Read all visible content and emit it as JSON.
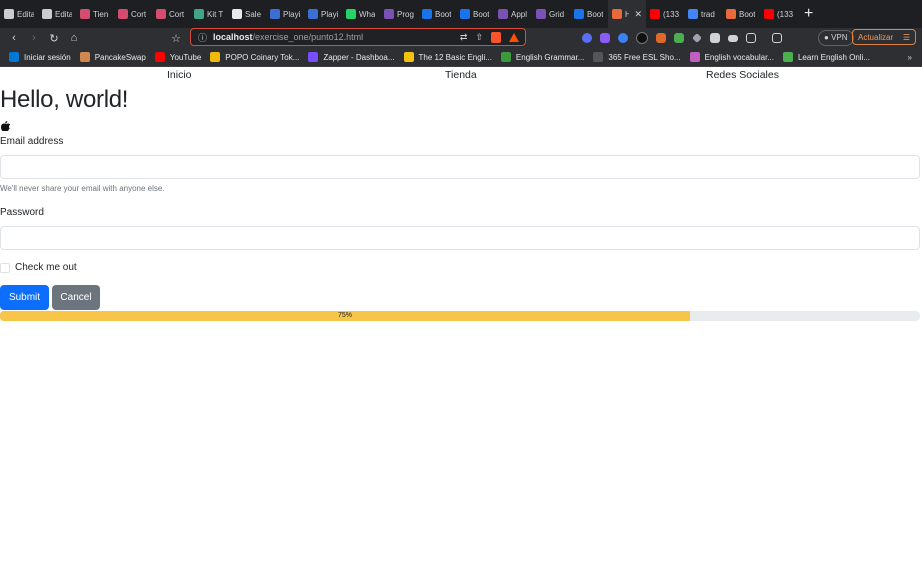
{
  "browser": {
    "tabs": [
      {
        "label": "Edita",
        "color": "#c9cdd2"
      },
      {
        "label": "Edita",
        "color": "#c9cdd2"
      },
      {
        "label": "Tien",
        "color": "#d44d6e"
      },
      {
        "label": "Cort",
        "color": "#d44d6e"
      },
      {
        "label": "Cort",
        "color": "#d44d6e"
      },
      {
        "label": "Kit T",
        "color": "#3fa68a"
      },
      {
        "label": "Sale",
        "color": "#e8eaed"
      },
      {
        "label": "Playi",
        "color": "#3b6fd4"
      },
      {
        "label": "Playi",
        "color": "#3b6fd4"
      },
      {
        "label": "Wha",
        "color": "#25d366"
      },
      {
        "label": "Prog",
        "color": "#7952b3"
      },
      {
        "label": "Boot",
        "color": "#1a73e8"
      },
      {
        "label": "Boot",
        "color": "#1a73e8"
      },
      {
        "label": "Appl",
        "color": "#7952b3"
      },
      {
        "label": "Grid",
        "color": "#7952b3"
      },
      {
        "label": "Boot",
        "color": "#1a73e8"
      },
      {
        "label": "H",
        "color": "#e86a3c",
        "active": true
      },
      {
        "label": "(133",
        "color": "#ff0000"
      },
      {
        "label": "trad",
        "color": "#4285f4"
      },
      {
        "label": "Boot",
        "color": "#e86a3c"
      },
      {
        "label": "(133",
        "color": "#ff0000"
      }
    ],
    "url_host": "localhost",
    "url_path": "/exercise_one/punto12.html",
    "vpn_label": "VPN",
    "update_label": "Actualizar",
    "bookmarks": [
      {
        "label": "Iniciar sesión",
        "color": "#0078d4"
      },
      {
        "label": "PancakeSwap",
        "color": "#d1884f"
      },
      {
        "label": "YouTube",
        "color": "#ff0000"
      },
      {
        "label": "POPO Coinary Tok...",
        "color": "#f0b90b"
      },
      {
        "label": "Zapper - Dashboa...",
        "color": "#784ffe"
      },
      {
        "label": "The 12 Basic Engli...",
        "color": "#f4c20d"
      },
      {
        "label": "English Grammar...",
        "color": "#3c9a3c"
      },
      {
        "label": "365 Free ESL Sho...",
        "color": "#555555"
      },
      {
        "label": "English vocabular...",
        "color": "#c05fc0"
      },
      {
        "label": "Learn English Onli...",
        "color": "#4caf50"
      }
    ],
    "bookmarks_more": "»"
  },
  "page": {
    "nav": {
      "inicio": "Inicio",
      "tienda": "Tienda",
      "redes": "Redes Sociales"
    },
    "title": "Hello, world!",
    "email_label": "Email address",
    "email_help": "We'll never share your email with anyone else.",
    "password_label": "Password",
    "check_label": "Check me out",
    "submit_label": "Submit",
    "cancel_label": "Cancel",
    "progress_text": "75%",
    "progress_value": 0.75
  }
}
